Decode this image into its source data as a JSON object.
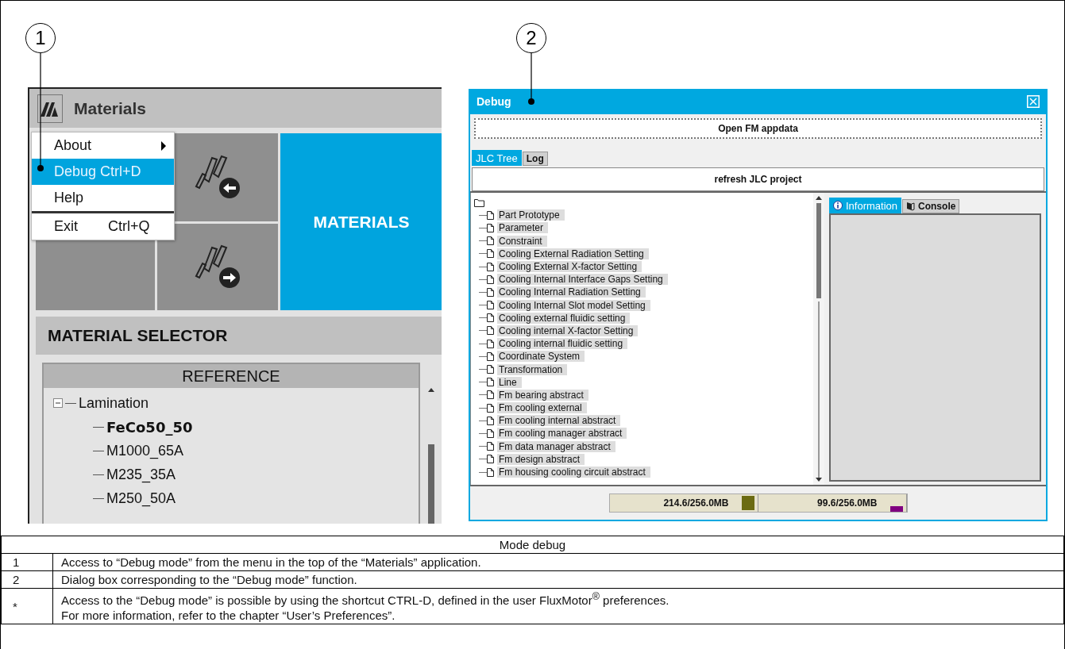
{
  "callouts": [
    {
      "number": "1"
    },
    {
      "number": "2"
    }
  ],
  "materials_app": {
    "title": "Materials",
    "menu": [
      {
        "label": "About",
        "kind": "submenu",
        "selected": false,
        "separator_before": false
      },
      {
        "label": "Debug Ctrl+D",
        "kind": "item",
        "selected": true,
        "separator_before": false
      },
      {
        "label": "Help",
        "kind": "item",
        "selected": false,
        "separator_before": false
      },
      {
        "label": "Exit",
        "shortcut": "Ctrl+Q",
        "kind": "item",
        "selected": false,
        "separator_before": true
      }
    ],
    "feature_tile": "MATERIALS",
    "selector_title": "MATERIAL SELECTOR",
    "tree": {
      "column": "REFERENCE",
      "items": [
        {
          "label": "Lamination",
          "expanded": true,
          "selected": false,
          "children": [
            {
              "label": "FeCo50_50",
              "selected": true
            },
            {
              "label": "M1000_65A",
              "selected": false
            },
            {
              "label": "M235_35A",
              "selected": false
            },
            {
              "label": "M250_50A",
              "selected": false
            }
          ]
        }
      ]
    }
  },
  "debug_dialog": {
    "title": "Debug",
    "open_button": "Open FM appdata",
    "tabs": [
      {
        "label": "JLC Tree",
        "selected": true
      },
      {
        "label": "Log",
        "selected": false
      }
    ],
    "refresh_button": "refresh JLC project",
    "tree_items": [
      "Part Prototype",
      "Parameter",
      "Constraint",
      "Cooling External Radiation Setting",
      "Cooling External X-factor Setting",
      "Cooling Internal Interface Gaps Setting",
      "Cooling Internal Radiation Setting",
      "Cooling Internal Slot model Setting",
      "Cooling external fluidic setting",
      "Cooling internal X-factor Setting",
      "Cooling internal fluidic setting",
      "Coordinate System",
      "Transformation",
      "Line",
      "Fm bearing abstract",
      "Fm cooling external",
      "Fm cooling internal abstract",
      "Fm cooling manager abstract",
      "Fm data manager abstract",
      "Fm design abstract",
      "Fm housing cooling circuit abstract"
    ],
    "side_tabs": [
      {
        "label": "Information",
        "kind": "info",
        "selected": true
      },
      {
        "label": "Console",
        "kind": "console",
        "selected": false
      }
    ],
    "memory": [
      {
        "reading": "214.6/256.0MB",
        "color": "#6b6b12"
      },
      {
        "reading": "99.6/256.0MB",
        "color": "#800080"
      }
    ]
  },
  "table": {
    "caption": "Mode debug",
    "rows": [
      {
        "marker": "1",
        "lines": [
          "Access to “Debug mode” from the menu in the top of the “Materials” application."
        ]
      },
      {
        "marker": "2",
        "lines": [
          "Dialog box corresponding to the “Debug mode” function."
        ]
      },
      {
        "marker": "*",
        "lines": [
          "Access to the “Debug mode” is possible by using the shortcut CTRL-D, defined in the user FluxMotor$^{®}$ preferences.",
          "For more information, refer to the chapter “User’s Preferences”."
        ]
      }
    ]
  }
}
